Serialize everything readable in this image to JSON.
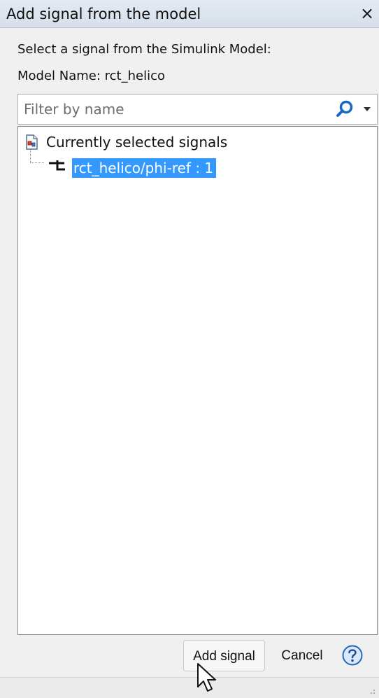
{
  "window": {
    "title": "Add signal from the model",
    "close_symbol": "×"
  },
  "prompt": "Select a signal from the Simulink Model:",
  "model_name": "Model Name: rct_helico",
  "filter": {
    "placeholder": "Filter by name",
    "value": "",
    "search_icon": "search-icon",
    "dropdown_icon": "chevron-down-icon"
  },
  "tree": {
    "root": {
      "label": "Currently selected signals",
      "icon": "model-document-icon"
    },
    "items": [
      {
        "label": "rct_helico/phi-ref : 1",
        "icon": "signal-port-icon",
        "selected": true
      }
    ]
  },
  "buttons": {
    "add": "Add signal",
    "cancel": "Cancel",
    "help_icon": "help-icon"
  },
  "colors": {
    "selection": "#3399ff",
    "window_background": "#f0f0f0"
  }
}
